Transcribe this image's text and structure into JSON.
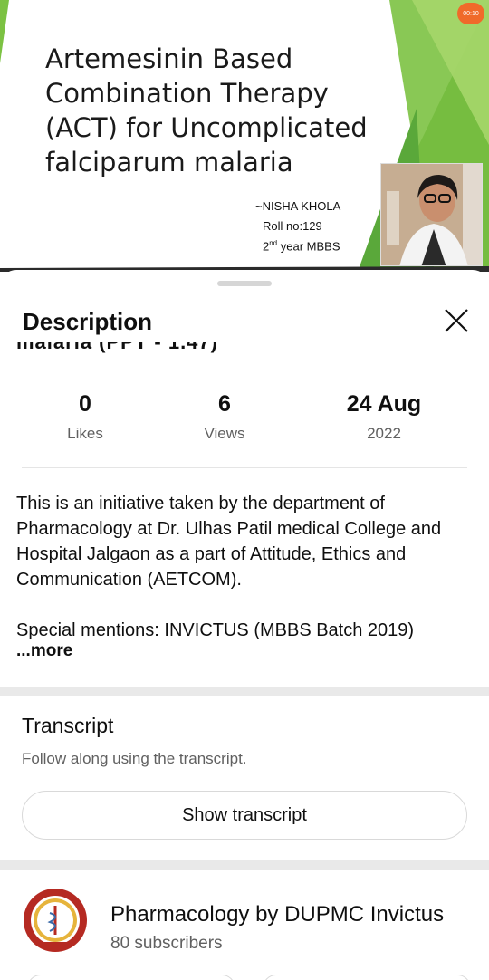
{
  "video": {
    "slide_title": "Artemesinin Based Combination Therapy (ACT) for Uncomplicated falciparum malaria",
    "author": "~NISHA KHOLA",
    "roll": "Roll no:129",
    "year_num": "2",
    "year_sup": "nd",
    "year_rest": " year MBBS",
    "timer": "00:10"
  },
  "sheet": {
    "title": "Description",
    "clipped_title_fragment": "malaria (PPT - 1.47)"
  },
  "stats": {
    "likes": {
      "value": "0",
      "label": "Likes"
    },
    "views": {
      "value": "6",
      "label": "Views"
    },
    "date": {
      "value": "24 Aug",
      "label": "2022"
    }
  },
  "description": {
    "paragraph1": "This is an initiative taken by the department of Pharmacology at Dr. Ulhas Patil medical College and Hospital Jalgaon as a part of Attitude, Ethics and Communication (AETCOM).",
    "paragraph2": "Special mentions: INVICTUS (MBBS Batch 2019)",
    "more": "...more"
  },
  "transcript": {
    "title": "Transcript",
    "subtitle": "Follow along using the transcript.",
    "button": "Show transcript"
  },
  "channel": {
    "name": "Pharmacology by DUPMC Invictus",
    "subscribers": "80 subscribers"
  },
  "colors": {
    "accent_green": "#7cc243",
    "dark_green": "#3f8f2a",
    "timer_orange": "#f06a2a",
    "logo_red": "#b52a22",
    "logo_gold": "#e6b43c"
  }
}
